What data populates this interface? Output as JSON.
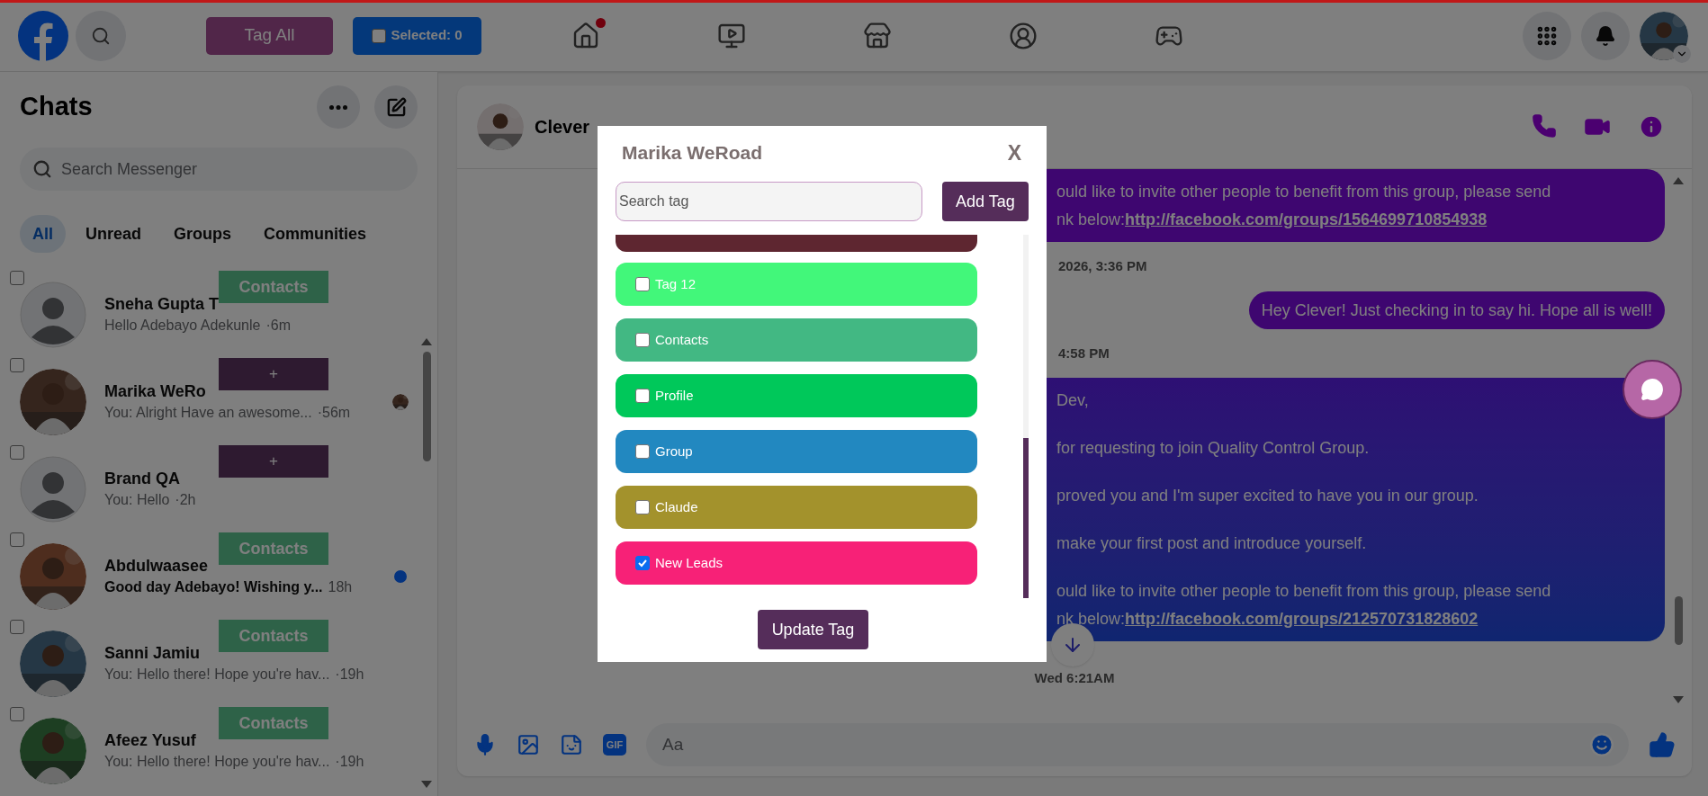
{
  "top_bar": {
    "tag_all_button": "Tag All",
    "selected_toggle": {
      "label": "Selected: 0",
      "checked": false
    },
    "nav": [
      {
        "kind": "home",
        "notification": true
      },
      {
        "kind": "video",
        "notification": false
      },
      {
        "kind": "store",
        "notification": false
      },
      {
        "kind": "groups",
        "notification": false
      },
      {
        "kind": "gaming",
        "notification": false
      }
    ]
  },
  "sidebar": {
    "title": "Chats",
    "search": {
      "placeholder": "Search Messenger"
    },
    "filters": [
      {
        "label": "All",
        "selected": true
      },
      {
        "label": "Unread",
        "selected": false
      },
      {
        "label": "Groups",
        "selected": false
      },
      {
        "label": "Communities",
        "selected": false
      }
    ],
    "chats": [
      {
        "name": "Sneha Gupta T",
        "preview": "Hello Adebayo Adekunle",
        "time": "·6m",
        "kind": "placeholder",
        "tag": {
          "kind": "tag",
          "label": "Contacts"
        },
        "unread": false,
        "seen": false,
        "checked": false
      },
      {
        "name": "Marika WeRo",
        "preview": "You: Alright Have an awesome...",
        "time": "·56m",
        "tag": {
          "kind": "add",
          "label": "+"
        },
        "unread": false,
        "seen": true,
        "checked": false
      },
      {
        "name": "Brand QA",
        "preview": "You: Hello",
        "time": "·2h",
        "kind": "placeholder",
        "tag": {
          "kind": "add",
          "label": "+"
        },
        "unread": false,
        "seen": false,
        "checked": false
      },
      {
        "name": "Abdulwaasee",
        "preview": "Good day Adebayo! Wishing y...",
        "time": "18h",
        "tag": {
          "kind": "tag",
          "label": "Contacts"
        },
        "unread": true,
        "seen": false,
        "checked": false
      },
      {
        "name": "Sanni Jamiu",
        "preview": "You: Hello there! Hope you're hav...",
        "time": "·19h",
        "tag": {
          "kind": "tag",
          "label": "Contacts"
        },
        "unread": false,
        "seen": false,
        "checked": false
      },
      {
        "name": "Afeez Yusuf",
        "preview": "You: Hello there! Hope you're hav...",
        "time": "·19h",
        "tag": {
          "kind": "tag",
          "label": "Contacts"
        },
        "unread": false,
        "seen": false,
        "checked": false
      }
    ]
  },
  "conversation": {
    "name": "Clever",
    "messages": [
      {
        "kind": "outgoing_cut",
        "gradient": false,
        "lines": [
          {
            "text": "ould like to invite other people to benefit from this group, please send"
          },
          {
            "text": "nk below:",
            "link": "http://facebook.com/groups/1564699710854938"
          }
        ]
      },
      {
        "kind": "timestamp_cut",
        "text": "2026, 3:36 PM"
      },
      {
        "kind": "outgoing",
        "gradient": false,
        "lines": [
          {
            "text": "Hey Clever! Just checking in to say hi. Hope all is well!"
          }
        ]
      },
      {
        "kind": "timestamp_cut",
        "text": "4:58 PM"
      },
      {
        "kind": "outgoing_cut",
        "gradient": true,
        "lines": [
          {
            "text": "Dev,"
          },
          {
            "text": "for requesting to join Quality Control Group."
          },
          {
            "text": "proved you and I'm super excited to have you in our group."
          },
          {
            "text": "make your first post and introduce yourself."
          },
          {
            "text": "ould like to invite other people to benefit from this group, please send"
          },
          {
            "text": "nk below:",
            "link": "http://facebook.com/groups/212570731828602"
          }
        ]
      },
      {
        "kind": "timestamp",
        "text": "Wed 6:21AM"
      }
    ],
    "composer": {
      "gif_label": "GIF",
      "placeholder": "Aa"
    }
  },
  "tag_dialog": {
    "title": "Marika WeRoad",
    "close": "X",
    "search": {
      "placeholder": "Search tag"
    },
    "add_button": "Add Tag",
    "tags": [
      {
        "color": "#5e2630"
      },
      {
        "label": "Tag 12",
        "color": "#42f77a",
        "checked": false
      },
      {
        "label": "Contacts",
        "color": "#42b883",
        "checked": false
      },
      {
        "label": "Profile",
        "color": "#00c85a",
        "checked": false
      },
      {
        "label": "Group",
        "color": "#2288c0",
        "checked": false
      },
      {
        "label": "Claude",
        "color": "#a3922c",
        "checked": false
      },
      {
        "label": "New Leads",
        "color": "#f72177",
        "checked": true
      }
    ],
    "update_button": "Update Tag",
    "scroll": {
      "level": 0.44
    }
  }
}
